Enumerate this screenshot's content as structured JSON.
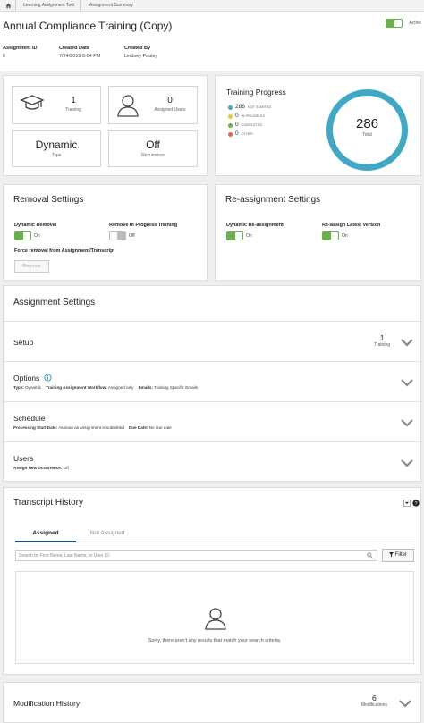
{
  "breadcrumb": {
    "home_icon": "home-icon",
    "items": [
      "Learning Assignment Tool",
      "Assignment Summary"
    ]
  },
  "header": {
    "title": "Annual Compliance Training (Copy)",
    "active_label": "Active",
    "meta": [
      {
        "key": "Assignment ID",
        "value": "6"
      },
      {
        "key": "Created Date",
        "value": "7/24/2019 6:04 PM"
      },
      {
        "key": "Created By",
        "value": "Lindsey Pauley"
      }
    ]
  },
  "stats": {
    "training": {
      "value": "1",
      "label": "Training",
      "icon": "graduation-cap-icon"
    },
    "users": {
      "value": "0",
      "label": "Assigned Users",
      "icon": "user-icon"
    },
    "type": {
      "value": "Dynamic",
      "label": "Type"
    },
    "recurrence": {
      "value": "Off",
      "label": "Recurrence"
    }
  },
  "progress": {
    "title": "Training Progress",
    "total": "286",
    "total_label": "Total",
    "legend": [
      {
        "count": "286",
        "name": "NOT STARTED",
        "color": "#3fa8c4"
      },
      {
        "count": "0",
        "name": "IN PROGRESS",
        "color": "#f1c232"
      },
      {
        "count": "0",
        "name": "COMPLETED",
        "color": "#6ab04c"
      },
      {
        "count": "0",
        "name": "OTHER",
        "color": "#e8663d"
      }
    ]
  },
  "removal": {
    "title": "Removal Settings",
    "dynamic_label": "Dynamic Removal",
    "dynamic_state": "On",
    "inprogress_label": "Remove In Progress Training",
    "inprogress_state": "Off",
    "force_label": "Force removal from Assignment/Transcript",
    "remove_button": "Remove"
  },
  "reassign": {
    "title": "Re-assignment Settings",
    "dynamic_label": "Dynamic Re-assignment",
    "dynamic_state": "On",
    "latest_label": "Re-assign Latest Version",
    "latest_state": "On"
  },
  "assignment_settings": {
    "title": "Assignment Settings",
    "setup": {
      "title": "Setup",
      "count": "1",
      "count_label": "Training"
    },
    "options": {
      "title": "Options",
      "type_key": "Type:",
      "type_val": "Dynamic",
      "workflow_key": "Training Assignment Workflow:",
      "workflow_val": "Assigned only",
      "emails_key": "Emails:",
      "emails_val": "Training Specific Emails"
    },
    "schedule": {
      "title": "Schedule",
      "start_key": "Processing Start Date:",
      "start_val": "As soon as Assignment is submitted",
      "due_key": "Due Date:",
      "due_val": "No due date"
    },
    "users": {
      "title": "Users",
      "occ_key": "Assign New Occurrence:",
      "occ_val": "Off"
    }
  },
  "transcript": {
    "title": "Transcript History",
    "tabs": [
      "Assigned",
      "Not Assigned"
    ],
    "search_placeholder": "Search by First Name, Last Name, or User ID.",
    "filter_label": "Filter",
    "empty_message": "Sorry, there aren't any results that match your search criteria."
  },
  "modification": {
    "title": "Modification History",
    "count": "6",
    "count_label": "Modifications"
  },
  "colors": {
    "toggle_on": "#6ab04c",
    "ring": "#3fa8c4",
    "tab_underline": "#1e4e79"
  }
}
